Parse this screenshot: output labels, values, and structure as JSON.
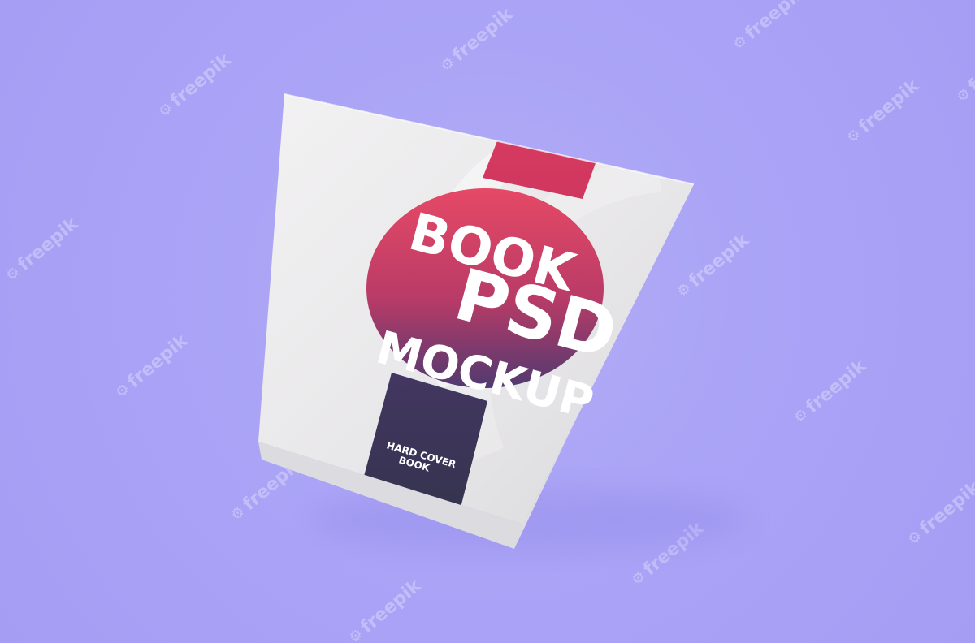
{
  "book": {
    "title_line_1": "BOOK",
    "title_line_2": "PSD",
    "title_line_3": "MOCKUP",
    "subtitle_line_1": "HARD COVER",
    "subtitle_line_2": "BOOK"
  },
  "watermark": {
    "text": "freepik",
    "icon": "freepik-logo-icon",
    "count_shown": 14
  },
  "colors": {
    "background": "#aba4f6",
    "cover": "#eceaed",
    "red_band": "#d73a63",
    "circle_top": "#e24564",
    "circle_bottom": "#5d3b72",
    "dark_band": "#3b3556",
    "text": "#ffffff"
  }
}
